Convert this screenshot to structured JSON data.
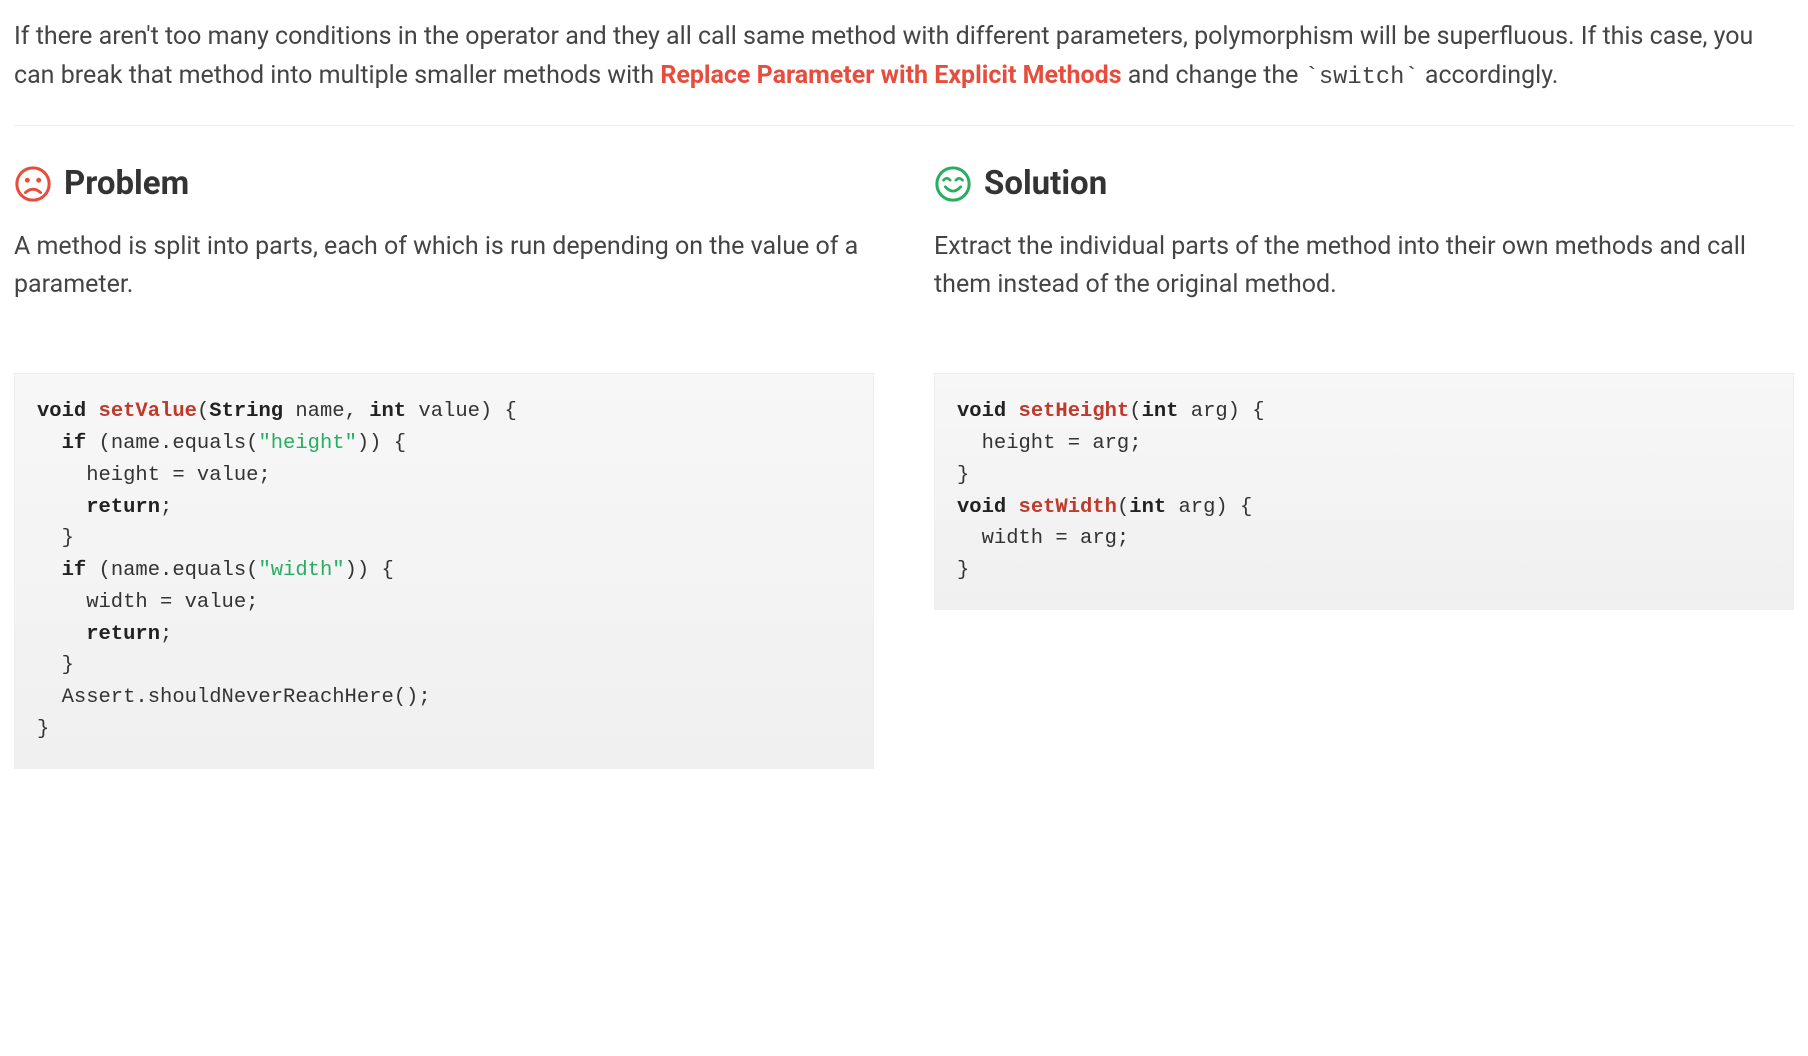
{
  "intro": {
    "pre": "If there aren't too many conditions in the operator and they all call same method with different parameters, polymorphism will be superfluous. If this case, you can break that method into multiple smaller methods with ",
    "link": "Replace Parameter with Explicit Methods",
    "post_and": " and change the ",
    "code": "`switch`",
    "post_accordingly": " accordingly."
  },
  "problem": {
    "heading": "Problem",
    "desc": "A method is split into parts, each of which is run depending on the value of a parameter.",
    "code": {
      "l1_kw": "void",
      "l1_fn": "setValue",
      "l1_open": "(",
      "l1_t1": "String",
      "l1_p1": " name, ",
      "l1_t2": "int",
      "l1_p2": " value) {",
      "l2_if": "if",
      "l2_rest": " (name.equals(",
      "l2_str": "\"height\"",
      "l2_close": ")) {",
      "l3": "    height = value;",
      "l4_ret": "return",
      "l4_semi": ";",
      "l5": "  }",
      "l6_if": "if",
      "l6_rest": " (name.equals(",
      "l6_str": "\"width\"",
      "l6_close": ")) {",
      "l7": "    width = value;",
      "l8_ret": "return",
      "l8_semi": ";",
      "l9": "  }",
      "l10": "  Assert.shouldNeverReachHere();",
      "l11": "}"
    }
  },
  "solution": {
    "heading": "Solution",
    "desc": "Extract the individual parts of the method into their own methods and call them instead of the original method.",
    "code": {
      "l1_kw": "void",
      "l1_fn": "setHeight",
      "l1_open": "(",
      "l1_t1": "int",
      "l1_rest": " arg) {",
      "l2": "  height = arg;",
      "l3": "}",
      "l4_kw": "void",
      "l4_fn": "setWidth",
      "l4_open": "(",
      "l4_t1": "int",
      "l4_rest": " arg) {",
      "l5": "  width = arg;",
      "l6": "}"
    }
  }
}
